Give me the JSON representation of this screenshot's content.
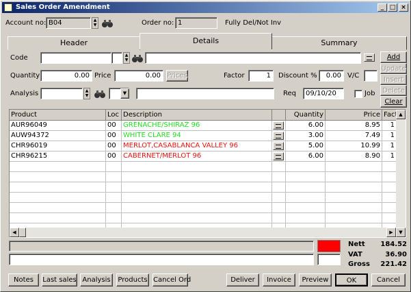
{
  "window": {
    "title": "Sales Order Amendment"
  },
  "top": {
    "account_label": "Account no:",
    "account_value": "B04",
    "order_label": "Order no:",
    "order_value": "1",
    "status_text": "Fully Del/Not Inv"
  },
  "tabs": [
    {
      "label": "Header"
    },
    {
      "label": "Details"
    },
    {
      "label": "Summary"
    }
  ],
  "form": {
    "code_label": "Code",
    "code_value": "",
    "description_value": "",
    "quantity_label": "Quantity",
    "quantity_value": "0.00",
    "price_label": "Price",
    "price_value": "0.00",
    "prices_button": "Prices",
    "factor_label": "Factor",
    "factor_value": "1",
    "discount_label": "Discount %",
    "discount_value": "0.00",
    "vc_label": "V/C",
    "vc_value": "",
    "analysis_label": "Analysis",
    "analysis_value": "",
    "analysis_desc": "",
    "req_label": "Req",
    "req_value": "09/10/20",
    "job_label": "Job"
  },
  "side_buttons": {
    "add": "Add",
    "update": "Update",
    "insert": "Insert",
    "delete": "Delete",
    "clear": "Clear"
  },
  "grid": {
    "columns": [
      "Product",
      "Loc",
      "Description",
      "",
      "Quantity",
      "Price",
      "Fact"
    ],
    "rows": [
      {
        "product": "AUR96049",
        "loc": "00",
        "description": "GRENACHE/SHIRAZ 96",
        "color": "#22dd22",
        "quantity": "6.00",
        "price": "8.95",
        "factor": "1"
      },
      {
        "product": "AUW94372",
        "loc": "00",
        "description": "WHITE CLARE 94",
        "color": "#22dd22",
        "quantity": "3.00",
        "price": "7.49",
        "factor": "1"
      },
      {
        "product": "CHR96019",
        "loc": "00",
        "description": "MERLOT,CASABLANCA VALLEY 96",
        "color": "#ee1111",
        "quantity": "5.00",
        "price": "10.99",
        "factor": "1"
      },
      {
        "product": "CHR96215",
        "loc": "00",
        "description": "CABERNET/MERLOT 96",
        "color": "#ee1111",
        "quantity": "6.00",
        "price": "8.90",
        "factor": "1"
      }
    ]
  },
  "status": {
    "indicator_color": "#ff0000"
  },
  "totals": {
    "nett_label": "Nett",
    "nett_value": "184.52",
    "vat_label": "VAT",
    "vat_value": "36.90",
    "gross_label": "Gross",
    "gross_value": "221.42"
  },
  "bottom_buttons": {
    "notes": "Notes",
    "last_sales": "Last sales",
    "analysis": "Analysis",
    "products": "Products",
    "cancel_ord": "Cancel Ord",
    "deliver": "Deliver",
    "invoice": "Invoice",
    "preview": "Preview",
    "ok": "OK",
    "cancel": "Cancel"
  },
  "icons": {
    "title_buttons": [
      "minimize-icon",
      "maximize-icon",
      "close-icon"
    ],
    "search": "binoculars-icon",
    "memo": "memo-icon"
  }
}
